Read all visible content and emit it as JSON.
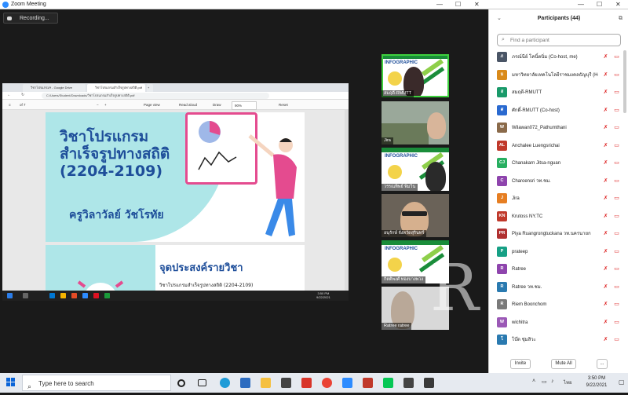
{
  "window": {
    "title": "Zoom Meeting"
  },
  "recording": {
    "label": "Recording..."
  },
  "shared_screen": {
    "tabs": [
      "วิชาโปรแกรมฯ - Google Drive",
      "วิชาโปรแกรมสำเร็จรูปทางสถิติ.pdf"
    ],
    "pdf_toolbar": {
      "page": "1",
      "of": "of 7",
      "page_view": "Page view",
      "read_aloud": "Read aloud",
      "draw": "Draw",
      "zoom": "90%",
      "reset": "Reset"
    },
    "page1": {
      "title_lines": [
        "วิชาโปรแกรม",
        "สำเร็จรูปทางสถิติ",
        "(2204-2109)"
      ],
      "teacher": "ครูวิลาวัลย์  วัชโรทัย"
    },
    "page2": {
      "heading": "จุดประสงค์รายวิชา",
      "subtext": "วิชาโปรแกรมสำเร็จรูปทางสถิติ (2204-2109)"
    },
    "inner_clock": {
      "time": "3:50 PM",
      "date": "9/22/2021"
    }
  },
  "video_tiles": [
    {
      "name": "สมฤดี-RMUTT",
      "poster": true,
      "poster_title": "INFOGRAPHIC"
    },
    {
      "name": "Jira",
      "poster": false
    },
    {
      "name": "วรรณทิพย์ พิ่มวิน",
      "poster": true,
      "poster_title": "INFOGRAPHIC"
    },
    {
      "name": "อนุรักษ์ จังหวัดสุรินทร์",
      "poster": false
    },
    {
      "name": "กิตติพงศ์ ทองบางพวง",
      "poster": true,
      "poster_title": "INFOGRAPHIC"
    },
    {
      "name": "Ratree ratree",
      "poster": false
    }
  ],
  "watermark": "R",
  "participants": {
    "title": "Participants (44)",
    "search_placeholder": "Find a participant",
    "items": [
      {
        "avatar": "ภ",
        "name": "ภรณ์นีย์ โคนิ์ตนิ่ม (Co-host, me)",
        "color": "#4a5566"
      },
      {
        "avatar": "ม",
        "name": "มหาวิทยาลัยเทคโนโลยีราชมงคลธัญบุรี (Host)",
        "color": "#d98a1a"
      },
      {
        "avatar": "ส",
        "name": "สมฤดี-RMUTT",
        "color": "#1a9a6a"
      },
      {
        "avatar": "ศ",
        "name": "ศักดิ์-RMUTT (Co-host)",
        "color": "#2a6ad0"
      },
      {
        "avatar": "W",
        "name": "Wilawan072_Pathumthani",
        "color": "#8a6a4a"
      },
      {
        "avatar": "AL",
        "name": "Anchalee Luengsrichai",
        "color": "#c0392b"
      },
      {
        "avatar": "CJ",
        "name": "Chanakarn Jitsa-nguan",
        "color": "#27ae60"
      },
      {
        "avatar": "C",
        "name": "Charoensri วท.ชม.",
        "color": "#8e44ad"
      },
      {
        "avatar": "J",
        "name": "Jira",
        "color": "#e67e22"
      },
      {
        "avatar": "KN",
        "name": "Krutoss NY.TC",
        "color": "#c0392b"
      },
      {
        "avatar": "PR",
        "name": "Piya Ruangrongtuckana วท.นครนายก",
        "color": "#b03030"
      },
      {
        "avatar": "P",
        "name": "prateep",
        "color": "#16a085"
      },
      {
        "avatar": "R",
        "name": "Ratree",
        "color": "#8e44ad"
      },
      {
        "avatar": "R",
        "name": "Ratree วท.ชม.",
        "color": "#2a7ab0"
      },
      {
        "avatar": "R",
        "name": "Riem Boonchom",
        "color": "#7a7a7a"
      },
      {
        "avatar": "W",
        "name": "wichitra",
        "color": "#9b59b6"
      },
      {
        "avatar": "โ",
        "name": "โบ๊ต ชุ่มสิวะ",
        "color": "#2a7ab0"
      }
    ],
    "footer": {
      "invite": "Invite",
      "mute_all": "Mute All",
      "more": "..."
    }
  },
  "taskbar": {
    "search_text": "Type here to search",
    "lang": "ไทย",
    "time": "3:50 PM",
    "date": "9/22/2021"
  }
}
